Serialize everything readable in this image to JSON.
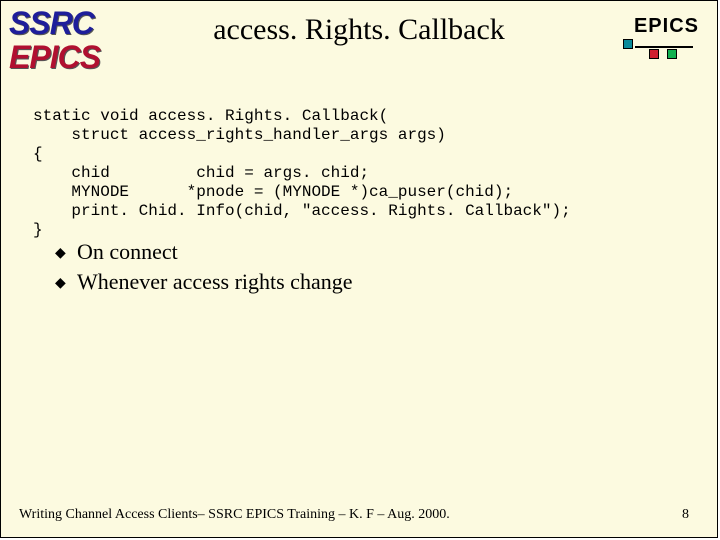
{
  "header": {
    "logo_top": "SSRC",
    "logo_bottom": "EPICS",
    "title": "access. Rights. Callback",
    "epics_label": "EPICS"
  },
  "code": "static void access. Rights. Callback(\n    struct access_rights_handler_args args)\n{\n    chid         chid = args. chid;\n    MYNODE      *pnode = (MYNODE *)ca_puser(chid);\n    print. Chid. Info(chid, \"access. Rights. Callback\");\n}",
  "bullets": [
    "On connect",
    "Whenever access rights change"
  ],
  "footer": {
    "text": "Writing Channel Access Clients– SSRC EPICS Training – K. F – Aug. 2000.",
    "page": "8"
  }
}
